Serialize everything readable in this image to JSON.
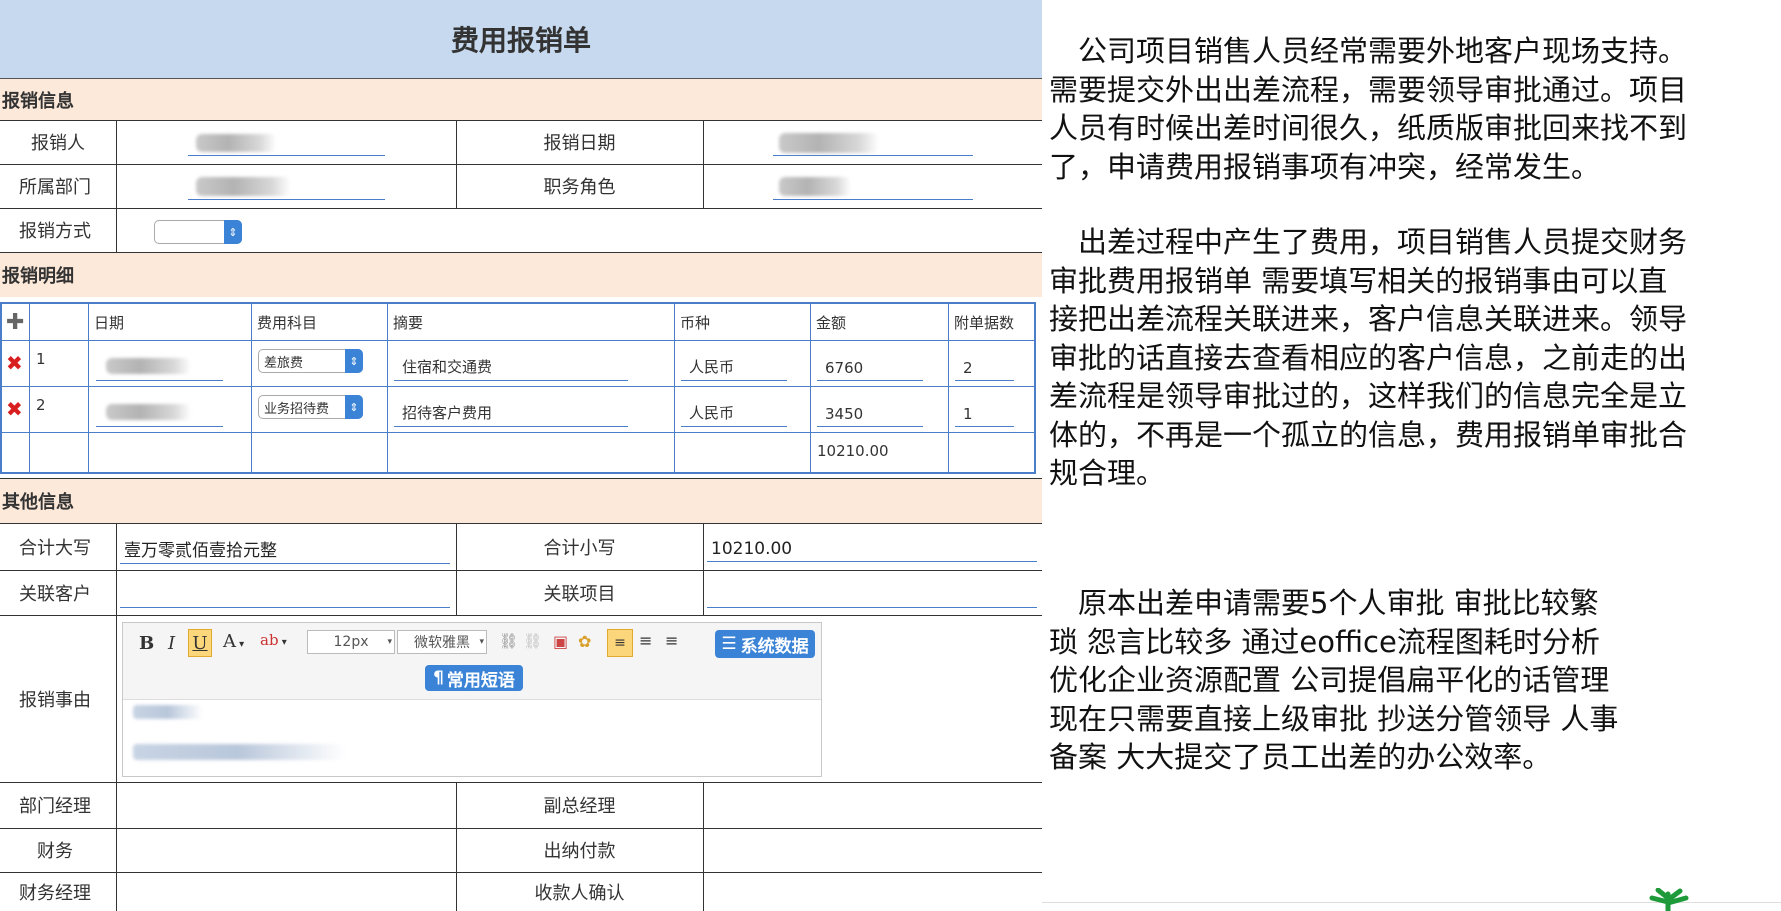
{
  "form": {
    "title": "费用报销单",
    "sections": {
      "info": "报销信息",
      "detail": "报销明细",
      "other": "其他信息"
    },
    "info": {
      "applicant_label": "报销人",
      "date_label": "报销日期",
      "department_label": "所属部门",
      "role_label": "职务角色",
      "method_label": "报销方式"
    },
    "detail": {
      "headers": [
        "日期",
        "费用科目",
        "摘要",
        "币种",
        "金额",
        "附单据数"
      ],
      "add_icon": "plus-icon",
      "rows": [
        {
          "no": "1",
          "category": "差旅费",
          "summary": "住宿和交通费",
          "currency": "人民币",
          "amount": "6760",
          "attachments": "2"
        },
        {
          "no": "2",
          "category": "业务招待费",
          "summary": "招待客户费用",
          "currency": "人民币",
          "amount": "3450",
          "attachments": "1"
        }
      ],
      "total": "10210.00"
    },
    "other": {
      "total_upper_label": "合计大写",
      "total_upper_value": "壹万零贰佰壹拾元整",
      "total_lower_label": "合计小写",
      "total_lower_value": "10210.00",
      "customer_label": "关联客户",
      "project_label": "关联项目",
      "reason_label": "报销事由",
      "dept_manager_label": "部门经理",
      "vp_label": "副总经理",
      "finance_label": "财务",
      "cashier_label": "出纳付款",
      "finance_manager_label": "财务经理",
      "payee_label": "收款人确认"
    },
    "editor": {
      "bold": "B",
      "italic": "I",
      "underline": "U",
      "font_color": "A",
      "font_size": "12px",
      "font_family": "微软雅黑",
      "system_data": "系统数据",
      "common_phrases": "常用短语"
    }
  },
  "text": {
    "p1": [
      "　公司项目销售人员经常需要外地客户现场支持。",
      "需要提交外出出差流程，需要领导审批通过。项目",
      "人员有时候出差时间很久，纸质版审批回来找不到",
      "了，申请费用报销事项有冲突，经常发生。"
    ],
    "p2": [
      "　出差过程中产生了费用，项目销售人员提交财务",
      "审批费用报销单  需要填写相关的报销事由可以直",
      "接把出差流程关联进来，客户信息关联进来。领导",
      "审批的话直接去查看相应的客户信息，之前走的出",
      "差流程是领导审批过的，这样我们的信息完全是立",
      "体的，不再是一个孤立的信息，费用报销单审批合",
      "规合理。"
    ],
    "p3": [
      "　原本出差申请需要5个人审批  审批比较繁",
      "琐  怨言比较多  通过eoffice流程图耗时分析",
      "优化企业资源配置  公司提倡扁平化的话管理",
      "现在只需要直接上级审批  抄送分管领导  人事",
      "备案  大大提交了员工出差的办公效率。"
    ]
  },
  "colors": {
    "title_bg": "#c6d9ef",
    "section_bg": "#fde9d9",
    "accent_blue": "#3b83d6",
    "delete_red": "#d81e1e"
  }
}
